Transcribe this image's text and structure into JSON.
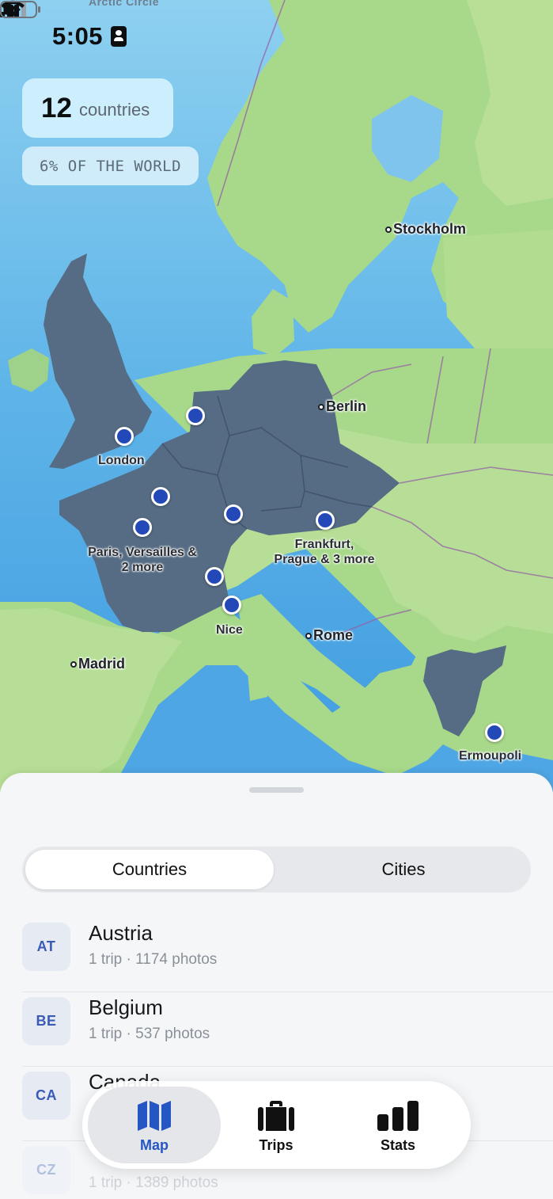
{
  "status_bar": {
    "time": "5:05"
  },
  "map": {
    "top_label": "Arctic Circle",
    "count": "12",
    "count_label": "countries",
    "world_pct": "6% OF THE WORLD",
    "cities": [
      "Stockholm",
      "Berlin",
      "Rome",
      "Madrid"
    ],
    "pins": {
      "london": "London",
      "paris_line1": "Paris, Versailles &",
      "paris_line2": "2 more",
      "frankfurt_line1": "Frankfurt,",
      "frankfurt_line2": "Prague & 3 more",
      "nice": "Nice",
      "ermoupoli": "Ermoupoli"
    },
    "colors": {
      "visited": "#556c84",
      "pin": "#2348b8"
    }
  },
  "segmented": {
    "countries": "Countries",
    "cities": "Cities",
    "selected": "Countries"
  },
  "countries": [
    {
      "code": "AT",
      "name": "Austria",
      "sub": "1 trip · 1174 photos"
    },
    {
      "code": "BE",
      "name": "Belgium",
      "sub": "1 trip · 537 photos"
    },
    {
      "code": "CA",
      "name": "Canada",
      "sub": ""
    },
    {
      "code": "CZ",
      "name": "",
      "sub": "1 trip · 1389 photos"
    }
  ],
  "tabs": [
    {
      "label": "Map",
      "icon": "map-icon",
      "selected": true
    },
    {
      "label": "Trips",
      "icon": "suitcase-icon",
      "selected": false
    },
    {
      "label": "Stats",
      "icon": "bar-chart-icon",
      "selected": false
    }
  ]
}
